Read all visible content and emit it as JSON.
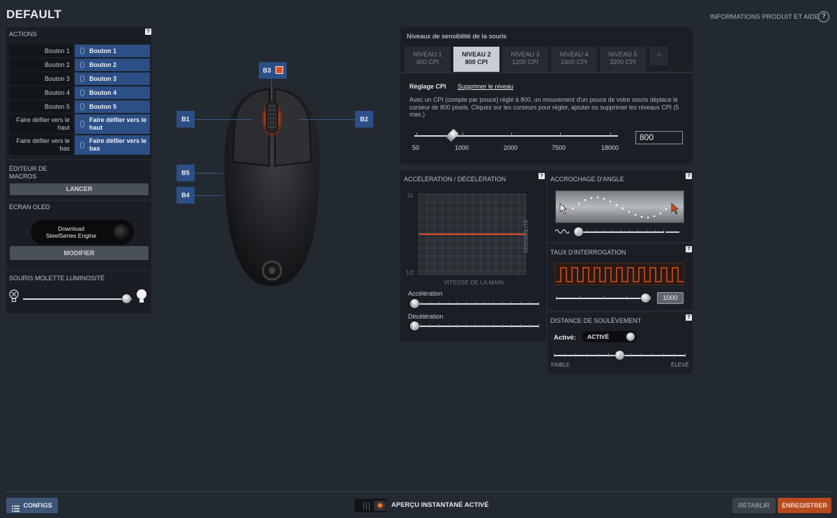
{
  "header": {
    "profile_title": "DEFAULT",
    "help_link": "INFORMATIONS PRODUIT ET AIDE",
    "help_icon": "?"
  },
  "actions": {
    "title": "ACTIONS",
    "help": "?",
    "rows": [
      {
        "label": "Bouton 1",
        "value": "Bouton 1"
      },
      {
        "label": "Bouton 2",
        "value": "Bouton 2"
      },
      {
        "label": "Bouton 3",
        "value": "Bouton 3"
      },
      {
        "label": "Bouton 4",
        "value": "Bouton 4"
      },
      {
        "label": "Bouton 5",
        "value": "Bouton 5"
      },
      {
        "label": "Faire défiler vers le haut",
        "value": "Faire défiler vers le haut"
      },
      {
        "label": "Faire défiler vers le bas",
        "value": "Faire défiler vers le bas"
      }
    ]
  },
  "macros": {
    "title": "ÉDITEUR DE MACROS",
    "button": "LANCER"
  },
  "oled": {
    "title": "ÉCRAN OLED",
    "download_line1": "Download",
    "download_line2": "SteelSeries Engine",
    "button": "MODIFIER"
  },
  "brightness": {
    "title": "SOURIS MOLETTE LUMINOSITÉ",
    "level": 0.95
  },
  "mouse_labels": {
    "b1": "B1",
    "b2": "B2",
    "b3": "B3",
    "b4": "B4",
    "b5": "B5"
  },
  "cpi": {
    "title": "Niveaux de sensibilité de la souris",
    "levels": [
      {
        "name": "NIVEAU 1",
        "value": "400 CPI"
      },
      {
        "name": "NIVEAU 2",
        "value": "800 CPI"
      },
      {
        "name": "NIVEAU 3",
        "value": "1200 CPI"
      },
      {
        "name": "NIVEAU 4",
        "value": "2400 CPI"
      },
      {
        "name": "NIVEAU 5",
        "value": "3200 CPI"
      }
    ],
    "active_level": 2,
    "add_label": "+",
    "setting_label": "Réglage CPI",
    "delete_link": "Supprimer le niveau",
    "description": "Avec un CPI (compte par pouce) réglé à 800, un mouvement d'un pouce de votre souris déplace le curseur de 800 pixels. Cliquez sur les curseurs pour régler, ajouter ou supprimer les niveaux CPI (5 max.)",
    "scale": [
      "50",
      "1000",
      "2000",
      "7500",
      "18000"
    ],
    "value": "800"
  },
  "acceleration": {
    "title": "ACCÉLÉRATION / DÉCÉLÉRATION",
    "help": "?",
    "y_top": "2x",
    "y_bottom": "1/2",
    "y_axis": "SENSIBILITÉ",
    "x_axis": "VITESSE DE LA MAIN",
    "accel_label": "Accélération",
    "decel_label": "Décélération",
    "accel_value": 0,
    "decel_value": 0
  },
  "angle_snapping": {
    "title": "ACCROCHAGE D'ANGLE",
    "help": "?",
    "level": 0
  },
  "polling": {
    "title": "TAUX D'INTERROGATION",
    "help": "?",
    "value": "1000"
  },
  "liftoff": {
    "title": "DISTANCE DE SOULÈVEMENT",
    "help": "?",
    "enabled_label": "Activé:",
    "toggle_text": "ACTIVÉ",
    "low": "FAIBLE",
    "high": "ÉLEVÉ",
    "level": 0.5
  },
  "footer": {
    "configs": "CONFIGS",
    "live_preview": "APERÇU INSTANTANÉ ACTIVÉ",
    "reset": "RÉTABLIR",
    "save": "ENREGISTRER"
  },
  "colors": {
    "accent": "#e0501e",
    "button_blue": "#2c4f86",
    "background": "#232931",
    "panel": "#1a1e24"
  }
}
